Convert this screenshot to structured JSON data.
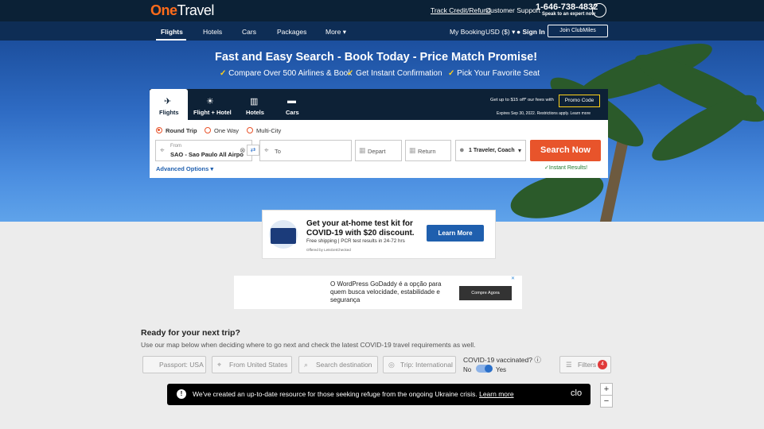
{
  "header": {
    "logo_one": "One",
    "logo_travel": "Travel",
    "track_credit": "Track Credit/Refund",
    "customer_support": "Customer Support",
    "phone": "1-646-738-4832",
    "phone_sub": "Speak to an expert now"
  },
  "nav": {
    "items": [
      "Flights",
      "Hotels",
      "Cars",
      "Packages",
      "More"
    ],
    "my_booking": "My Booking",
    "currency": "USD ($)",
    "sign_in": "Sign In",
    "join": "Join ClubMiles"
  },
  "hero": {
    "title": "Fast and Easy Search - Book Today - Price Match Promise!",
    "bullets": [
      "Compare Over 500 Airlines & Book",
      "Get Instant Confirmation",
      "Pick Your Favorite Seat"
    ]
  },
  "search": {
    "tabs": [
      "Flights",
      "Flight + Hotel",
      "Hotels",
      "Cars"
    ],
    "promo_text": "Get up to $15 off* our fees with",
    "promo_button": "Promo Code",
    "promo_expiry": "Expires Sep 30, 2022. Restrictions apply. Learn more",
    "trip_types": [
      "Round Trip",
      "One Way",
      "Multi-City"
    ],
    "from_label": "From",
    "from_value": "SAO - Sao Paulo All Airpo",
    "to_placeholder": "To",
    "depart_placeholder": "Depart",
    "return_placeholder": "Return",
    "travelers": "1 Traveler, Coach",
    "search_button": "Search Now",
    "advanced": "Advanced Options",
    "instant": "Instant Results!"
  },
  "ad": {
    "title": "Get your at-home test kit for COVID-19 with $20 discount.",
    "sub": "Free shipping | PCR test results in 24-72 hrs",
    "by": "Offered by LetsGetChecked",
    "button": "Learn More"
  },
  "banner": {
    "text": "O WordPress GoDaddy é a opção para quem busca velocidade, estabilidade e segurança",
    "button": "Compre Agora"
  },
  "map": {
    "title": "Ready for your next trip?",
    "sub": "Use our map below when deciding where to go next and check the latest COVID-19 travel requirements as well.",
    "passport": "Passport: USA",
    "from": "From United States",
    "search": "Search destination",
    "trip": "Trip: International",
    "vaccinated": "COVID-19 vaccinated?",
    "no": "No",
    "yes": "Yes",
    "filters": "Filters",
    "filters_count": "4",
    "notice": "We've created an up-to-date resource for those seeking refuge from the ongoing Ukraine crisis.",
    "notice_link": "Learn more",
    "close": "clo"
  }
}
